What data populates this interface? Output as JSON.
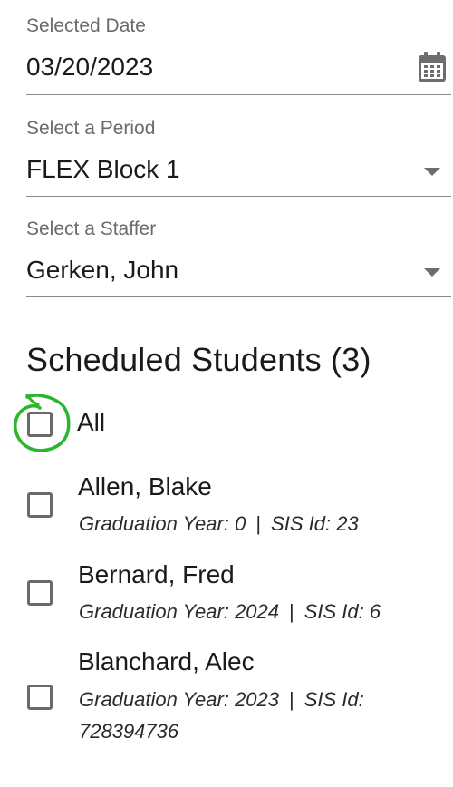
{
  "date_field": {
    "label": "Selected Date",
    "value": "03/20/2023",
    "icon": "calendar-icon"
  },
  "period_field": {
    "label": "Select a Period",
    "value": "FLEX Block 1",
    "icon": "chevron-down-icon"
  },
  "staffer_field": {
    "label": "Select a Staffer",
    "value": "Gerken, John",
    "icon": "chevron-down-icon"
  },
  "students": {
    "title": "Scheduled Students (3)",
    "select_all_label": "All",
    "grad_year_prefix": "Graduation Year:",
    "separator": "|",
    "sis_prefix": "SIS Id:",
    "items": [
      {
        "name": "Allen, Blake",
        "grad_year": "0",
        "sis_id": "23"
      },
      {
        "name": "Bernard, Fred",
        "grad_year": "2024",
        "sis_id": "6"
      },
      {
        "name": "Blanchard, Alec",
        "grad_year": "2023",
        "sis_id": "728394736"
      }
    ]
  },
  "colors": {
    "highlight_circle": "#2db52d",
    "checkbox_border": "#6a6a6a",
    "field_underline": "#8a8a8a",
    "label_gray": "#6b6b6b"
  }
}
